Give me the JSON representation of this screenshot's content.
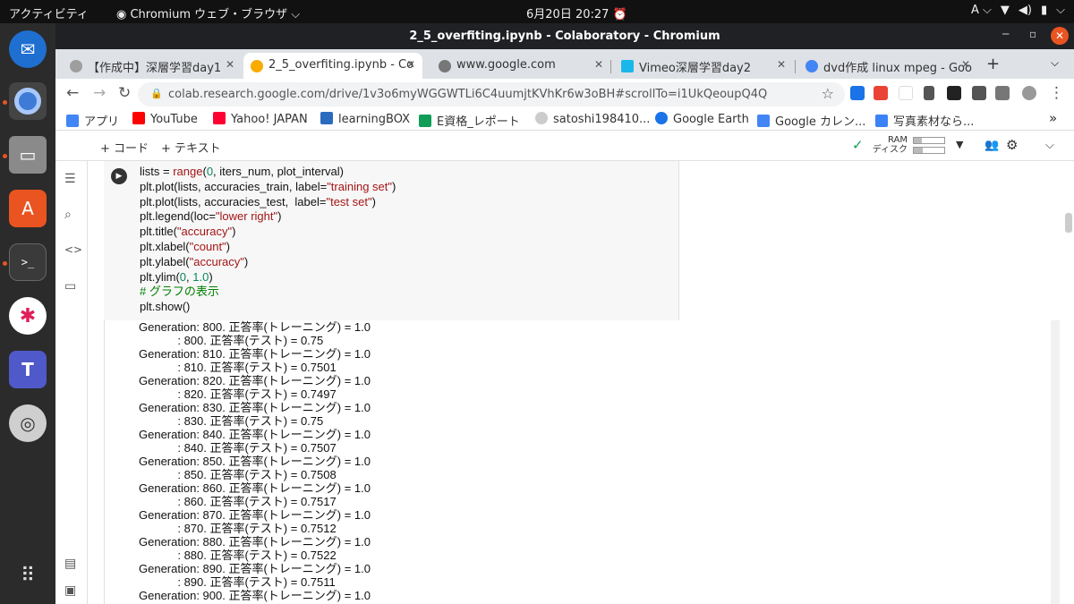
{
  "topbar": {
    "activities": "アクティビティ",
    "app": "Chromium ウェブ・ブラウザ ⌵",
    "datetime": "6月20日  20:27",
    "input_method": "A ⌵"
  },
  "window": {
    "title": "2_5_overfiting.ipynb - Colaboratory - Chromium"
  },
  "tabs": [
    {
      "label": "【作成中】深層学習day1",
      "fav_color": "#9e9e9e"
    },
    {
      "label": "2_5_overfiting.ipynb - Co",
      "fav_color": "#f9ab00"
    },
    {
      "label": "www.google.com",
      "fav_color": "#777777"
    },
    {
      "label": "Vimeo深層学習day2",
      "fav_color": "#1ab7ea"
    },
    {
      "label": "dvd作成 linux mpeg - Goo",
      "fav_color": "#4285f4"
    }
  ],
  "omnibox": {
    "url": "colab.research.google.com/drive/1v3o6myWGGWTLi6C4uumjtKVhKr6w3oBH#scrollTo=i1UkQeoupQ4Q"
  },
  "bookmarks": [
    {
      "label": "アプリ",
      "color": "#4285f4"
    },
    {
      "label": "YouTube",
      "color": "#ff0000"
    },
    {
      "label": "Yahoo! JAPAN",
      "color": "#ff0033"
    },
    {
      "label": "learningBOX",
      "color": "#2a6bbf"
    },
    {
      "label": "E資格_レポート",
      "color": "#0f9d58"
    },
    {
      "label": "satoshi198410...",
      "color": "#cccccc"
    },
    {
      "label": "Google Earth",
      "color": "#1a73e8"
    },
    {
      "label": "Google カレン...",
      "color": "#4285f4"
    },
    {
      "label": "写真素材なら...",
      "color": "#3b82f6"
    }
  ],
  "colab": {
    "add_code": "+ コード",
    "add_text": "+ テキスト",
    "ram_label": "RAM",
    "disk_label": "ディスク",
    "ram_fill": 0.25,
    "disk_fill": 0.3
  },
  "code_lines": [
    [
      {
        "t": "lists = "
      },
      {
        "t": "range",
        "c": "str"
      },
      {
        "t": "("
      },
      {
        "t": "0",
        "c": "num"
      },
      {
        "t": ", iters_num, plot_interval)"
      }
    ],
    [
      {
        "t": "plt.plot(lists, accuracies_train, label="
      },
      {
        "t": "\"training set\"",
        "c": "str"
      },
      {
        "t": ")"
      }
    ],
    [
      {
        "t": "plt.plot(lists, accuracies_test,  label="
      },
      {
        "t": "\"test set\"",
        "c": "str"
      },
      {
        "t": ")"
      }
    ],
    [
      {
        "t": "plt.legend(loc="
      },
      {
        "t": "\"lower right\"",
        "c": "str"
      },
      {
        "t": ")"
      }
    ],
    [
      {
        "t": "plt.title("
      },
      {
        "t": "\"accuracy\"",
        "c": "str"
      },
      {
        "t": ")"
      }
    ],
    [
      {
        "t": "plt.xlabel("
      },
      {
        "t": "\"count\"",
        "c": "str"
      },
      {
        "t": ")"
      }
    ],
    [
      {
        "t": "plt.ylabel("
      },
      {
        "t": "\"accuracy\"",
        "c": "str"
      },
      {
        "t": ")"
      }
    ],
    [
      {
        "t": "plt.ylim("
      },
      {
        "t": "0",
        "c": "num"
      },
      {
        "t": ", "
      },
      {
        "t": "1.0",
        "c": "num"
      },
      {
        "t": ")"
      }
    ],
    [
      {
        "t": "# グラフの表示",
        "c": "cmt"
      }
    ],
    [
      {
        "t": "plt.show()"
      }
    ]
  ],
  "output_lines": [
    "Generation: 800. 正答率(トレーニング) = 1.0",
    "            : 800. 正答率(テスト) = 0.75",
    "Generation: 810. 正答率(トレーニング) = 1.0",
    "            : 810. 正答率(テスト) = 0.7501",
    "Generation: 820. 正答率(トレーニング) = 1.0",
    "            : 820. 正答率(テスト) = 0.7497",
    "Generation: 830. 正答率(トレーニング) = 1.0",
    "            : 830. 正答率(テスト) = 0.75",
    "Generation: 840. 正答率(トレーニング) = 1.0",
    "            : 840. 正答率(テスト) = 0.7507",
    "Generation: 850. 正答率(トレーニング) = 1.0",
    "            : 850. 正答率(テスト) = 0.7508",
    "Generation: 860. 正答率(トレーニング) = 1.0",
    "            : 860. 正答率(テスト) = 0.7517",
    "Generation: 870. 正答率(トレーニング) = 1.0",
    "            : 870. 正答率(テスト) = 0.7512",
    "Generation: 880. 正答率(トレーニング) = 1.0",
    "            : 880. 正答率(テスト) = 0.7522",
    "Generation: 890. 正答率(トレーニング) = 1.0",
    "            : 890. 正答率(テスト) = 0.7511",
    "Generation: 900. 正答率(トレーニング) = 1.0"
  ],
  "dock": [
    {
      "name": "thunderbird-icon",
      "color": "#1f6fd0"
    },
    {
      "name": "chromium-icon",
      "color": "#3e7bd6"
    },
    {
      "name": "files-icon",
      "color": "#7a7a7a"
    },
    {
      "name": "software-center-icon",
      "color": "#e95420"
    },
    {
      "name": "terminal-icon",
      "color": "#3a3a3a"
    },
    {
      "name": "slack-icon",
      "color": "#ffffff"
    },
    {
      "name": "teams-icon",
      "color": "#5059c9"
    },
    {
      "name": "dvd-icon",
      "color": "#cfcfcf"
    }
  ]
}
